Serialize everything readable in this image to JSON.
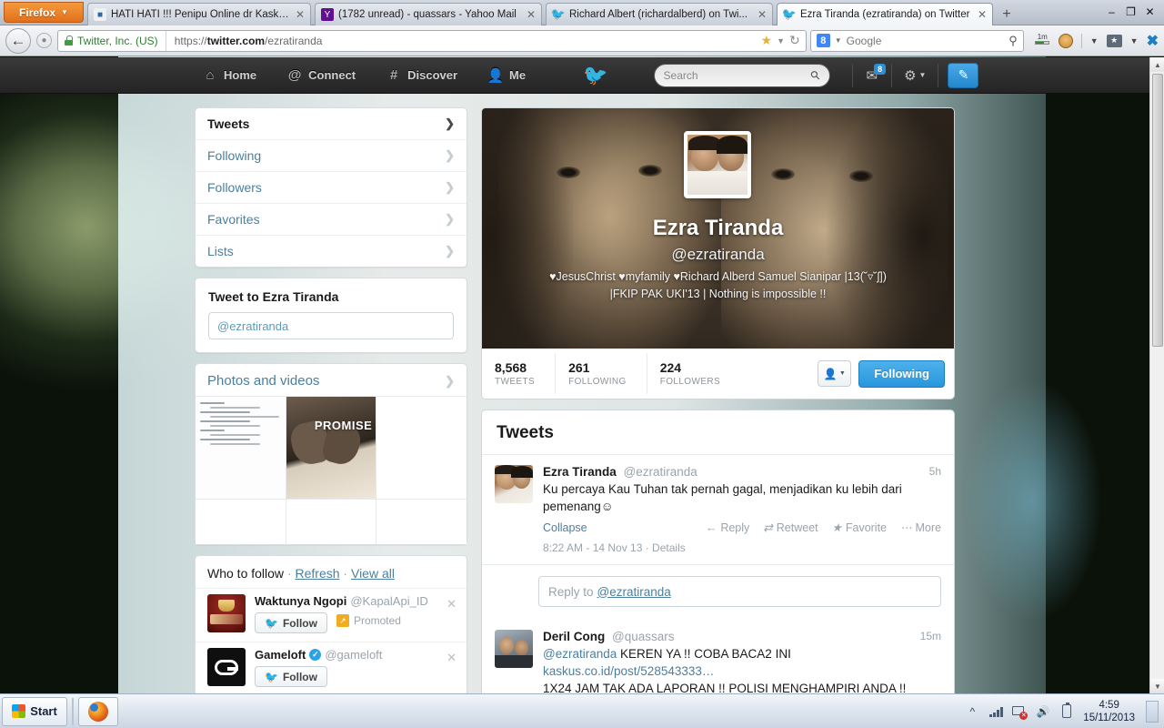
{
  "browser": {
    "firefox_button": "Firefox",
    "tabs": [
      {
        "title": "HATI HATI !!! Penipu Online dr Kasku...",
        "favicon": "kaskus-icon",
        "active": false
      },
      {
        "title": "(1782 unread) - quassars - Yahoo Mail",
        "favicon": "yahoo-icon",
        "active": false
      },
      {
        "title": "Richard Albert (richardalberd) on Twi...",
        "favicon": "twitter-icon",
        "active": false
      },
      {
        "title": "Ezra Tiranda (ezratiranda) on Twitter",
        "favicon": "twitter-icon",
        "active": true
      }
    ],
    "new_tab_label": "+",
    "window_controls": {
      "minimize": "–",
      "restore": "❐",
      "close": "✕"
    },
    "identity_label": "Twitter, Inc. (US)",
    "url_scheme": "https://",
    "url_domain": "twitter.com",
    "url_path": "/ezratiranda",
    "search_engine": "Google",
    "search_placeholder": "Google",
    "meter_label": "1m"
  },
  "twitter_nav": {
    "links": [
      {
        "label": "Home",
        "icon": "home-icon"
      },
      {
        "label": "Connect",
        "icon": "at-icon"
      },
      {
        "label": "Discover",
        "icon": "hash-icon"
      },
      {
        "label": "Me",
        "icon": "person-icon"
      }
    ],
    "search_placeholder": "Search",
    "messages_badge": "8",
    "bird_icon": "twitter-bird-icon",
    "compose_icon": "compose-icon"
  },
  "sidebar": {
    "nav_items": [
      {
        "label": "Tweets",
        "selected": true
      },
      {
        "label": "Following",
        "selected": false
      },
      {
        "label": "Followers",
        "selected": false
      },
      {
        "label": "Favorites",
        "selected": false
      },
      {
        "label": "Lists",
        "selected": false
      }
    ],
    "tweet_to": {
      "title": "Tweet to Ezra Tiranda",
      "input_value": "@ezratiranda"
    },
    "photos_and_videos": {
      "title": "Photos and videos",
      "promise_caption": "PROMISE"
    },
    "who_to_follow": {
      "title": "Who to follow",
      "refresh_label": "Refresh",
      "view_all_label": "View all",
      "separator": "·",
      "suggestions": [
        {
          "name": "Waktunya Ngopi",
          "handle": "@KapalApi_ID",
          "follow_label": "Follow",
          "promoted_label": "Promoted",
          "verified": false,
          "avatar": "kapalapi-avatar"
        },
        {
          "name": "Gameloft",
          "handle": "@gameloft",
          "follow_label": "Follow",
          "promoted_label": "",
          "verified": true,
          "avatar": "gameloft-avatar"
        }
      ]
    }
  },
  "profile": {
    "display_name": "Ezra Tiranda",
    "handle": "@ezratiranda",
    "bio_line1": "♥JesusChrist ♥myfamily ♥Richard Alberd Samuel Sianipar |13(˘▿˘ʃ])",
    "bio_line2": "|FKIP PAK UKI'13 | Nothing is impossible !!",
    "stats": [
      {
        "value": "8,568",
        "label": "TWEETS"
      },
      {
        "value": "261",
        "label": "FOLLOWING"
      },
      {
        "value": "224",
        "label": "FOLLOWERS"
      }
    ],
    "user_actions_icon": "person-dropdown-icon",
    "following_button": "Following"
  },
  "stream": {
    "title": "Tweets",
    "tweets": [
      {
        "name": "Ezra Tiranda",
        "handle": "@ezratiranda",
        "time": "5h",
        "text": "Ku percaya Kau Tuhan tak pernah gagal, menjadikan ku lebih dari pemenang☺",
        "collapse_label": "Collapse",
        "actions": [
          {
            "label": "Reply",
            "icon": "reply-arrow-icon"
          },
          {
            "label": "Retweet",
            "icon": "retweet-icon"
          },
          {
            "label": "Favorite",
            "icon": "star-icon"
          },
          {
            "label": "More",
            "icon": "ellipsis-icon"
          }
        ],
        "meta": "8:22 AM - 14 Nov 13 · Details",
        "reply_placeholder": "Reply to",
        "reply_handle": "@ezratiranda"
      },
      {
        "name": "Deril Cong",
        "handle": "@quassars",
        "time": "15m",
        "mention": "@ezratiranda",
        "text_part1": " KEREN YA !! COBA BACA2 INI ",
        "link": "kaskus.co.id/post/528543333…",
        "text_part2": "1X24 JAM TAK ADA LAPORAN !! POLISI MENGHAMPIRI ANDA !!"
      }
    ]
  },
  "taskbar": {
    "start_label": "Start",
    "items": [
      {
        "label": "",
        "icon": "firefox-icon"
      }
    ],
    "tray_icons": [
      "show-hidden-icon",
      "network-signal-icon",
      "network-error-icon",
      "volume-icon",
      "battery-icon"
    ],
    "clock_time": "4:59",
    "clock_date": "15/11/2013"
  }
}
